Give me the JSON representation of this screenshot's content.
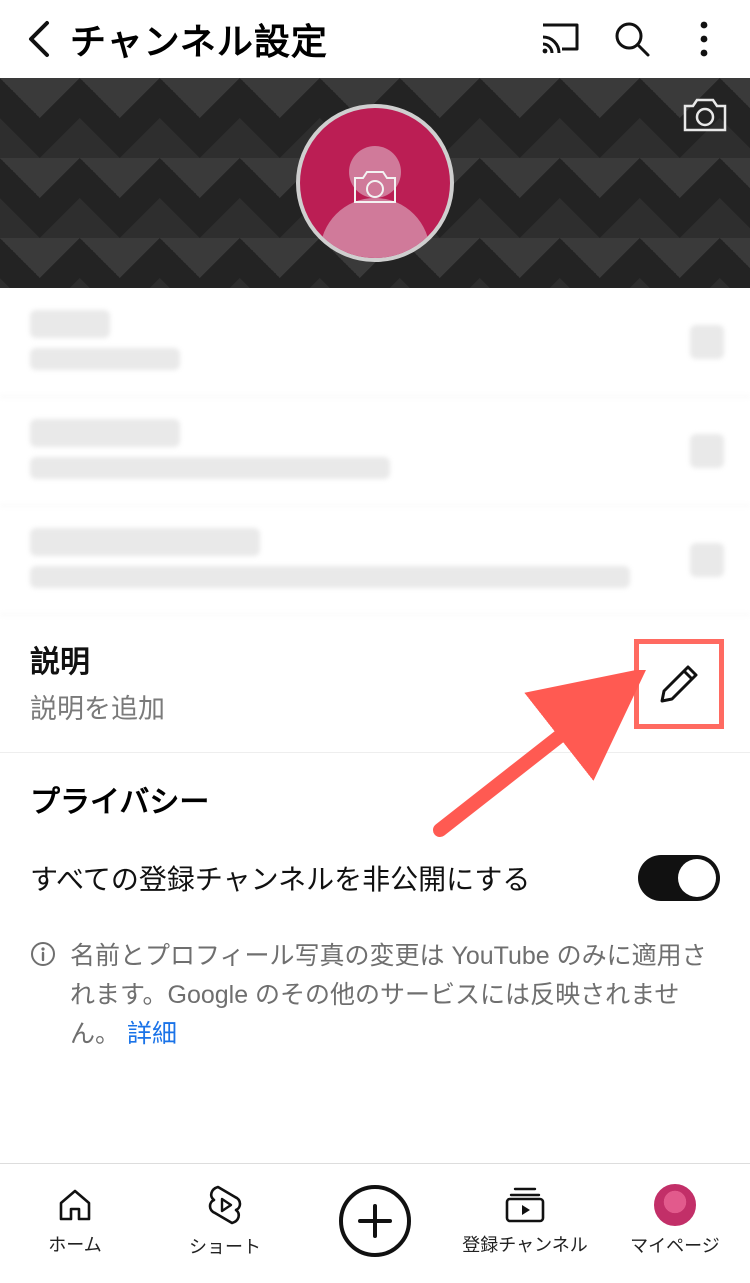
{
  "header": {
    "title": "チャンネル設定"
  },
  "description_row": {
    "title": "説明",
    "placeholder": "説明を追加"
  },
  "privacy": {
    "header": "プライバシー",
    "toggle_label": "すべての登録チャンネルを非公開にする",
    "toggle_on": true
  },
  "info_note": {
    "text": "名前とプロフィール写真の変更は YouTube のみに適用されます。Google のその他のサービスには反映されません。",
    "link_text": "詳細"
  },
  "bottom_nav": {
    "home": "ホーム",
    "shorts": "ショート",
    "subscriptions": "登録チャンネル",
    "mypage": "マイページ"
  }
}
